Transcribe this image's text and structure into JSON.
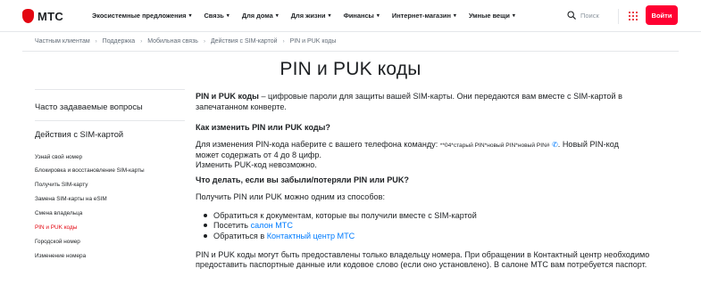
{
  "header": {
    "logo_text": "МТС",
    "nav": [
      {
        "label": "Экосистемные предложения"
      },
      {
        "label": "Связь"
      },
      {
        "label": "Для дома"
      },
      {
        "label": "Для жизни"
      },
      {
        "label": "Финансы"
      },
      {
        "label": "Интернет-магазин"
      },
      {
        "label": "Умные вещи"
      }
    ],
    "search_label": "Поиск",
    "login_label": "Войти"
  },
  "breadcrumb": [
    "Частным клиентам",
    "Поддержка",
    "Мобильная связь",
    "Действия с SIM-картой",
    "PIN и PUK коды"
  ],
  "page_title": "PIN и PUK коды",
  "sidebar": {
    "faq_title": "Часто задаваемые вопросы",
    "section_title": "Действия с SIM-картой",
    "items": [
      {
        "label": "Узнай свой номер"
      },
      {
        "label": "Блокировка и восстановление SIM-карты"
      },
      {
        "label": "Получить SIM-карту"
      },
      {
        "label": "Замена SIM-карты на eSIM"
      },
      {
        "label": "Смена владельца"
      },
      {
        "label": "PIN и PUK коды"
      },
      {
        "label": "Городской номер"
      },
      {
        "label": "Изменение номера"
      }
    ]
  },
  "content": {
    "intro_bold": "PIN и PUK коды",
    "intro_rest_1": " – цифровые пароли для защиты вашей SIM-карты. Они передаются вам вместе с SIM-картой в",
    "intro_rest_2": "запечатанном конверте.",
    "q1": "Как изменить PIN или PUK коды?",
    "a1_start": "Для изменения PIN-кода наберите с вашего телефона команду: ",
    "a1_code": "**04*старый PIN*новый PIN*новый PIN#",
    "a1_end": ". Новый PIN-код",
    "a1_line2": "может содержать от 4 до 8 цифр.",
    "a1_line3": "Изменить PUK-код невозможно.",
    "q2": "Что делать, если вы забыли/потеряли PIN или PUK?",
    "a2_intro": "Получить PIN или PUK можно одним из способов:",
    "b1": "Обратиться к документам, которые вы получили вместе с SIM-картой",
    "b2_text": "Посетить ",
    "b2_link": "салон МТС",
    "b3_text": "Обратиться в ",
    "b3_link": "Контактный центр МТС",
    "final_1": "PIN и PUK коды могут быть предоставлены только владельцу номера. При обращении в Контактный центр необходимо",
    "final_2": "предоставить паспортные данные или кодовое слово (если оно установлено). В салоне МТС вам потребуется паспорт."
  },
  "colors": {
    "brand_red": "#e30611",
    "button_red": "#ff0032",
    "link_blue": "#007cff",
    "text": "#1d2023",
    "muted": "#626c77"
  },
  "icons": {
    "logo": "mts-egg-logo",
    "search": "search-icon",
    "apps": "grid-icon",
    "phone": "phone-icon",
    "nav_caret": "chevron-down-icon"
  }
}
